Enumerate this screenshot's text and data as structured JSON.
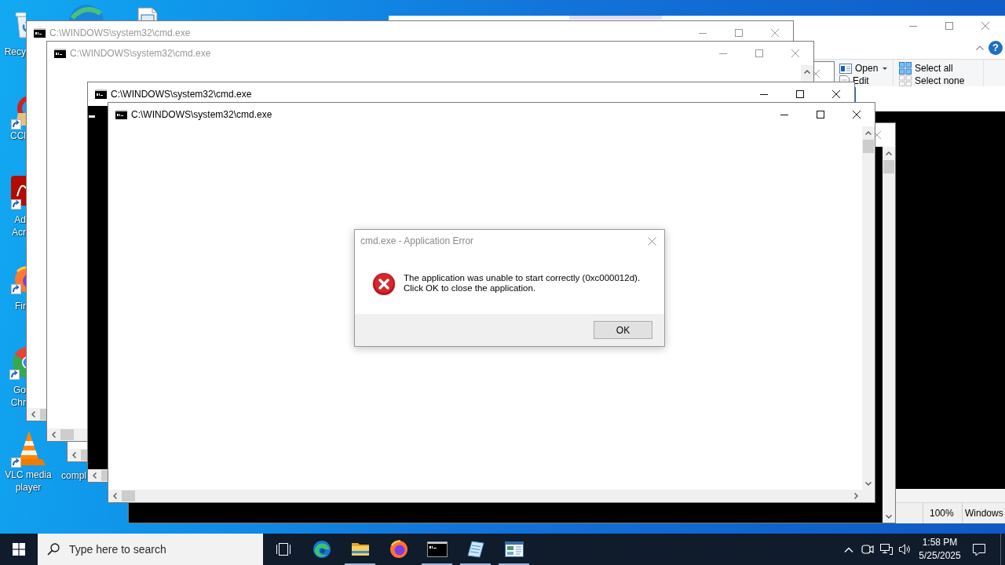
{
  "desktop_icons": [
    {
      "kind": "recycle",
      "label_lines": [
        "Recy"
      ]
    },
    {
      "kind": "swirl"
    },
    {
      "kind": "document"
    },
    {
      "kind": "cleaner",
      "label_lines": [
        "CCl"
      ]
    },
    {
      "kind": "pdf",
      "label_lines": [
        "Ad",
        "Acr"
      ]
    },
    {
      "kind": "fox",
      "label_lines": [
        "Fir"
      ]
    },
    {
      "kind": "browser",
      "label_lines": [
        "Go",
        "Chr"
      ]
    },
    {
      "kind": "cone",
      "label_lines": [
        "VLC media",
        "player"
      ]
    },
    {
      "kind": "hidden",
      "label_lines": [
        "compl"
      ]
    }
  ],
  "explorer": {
    "ribbon_groups": [
      {
        "items": [
          {
            "label": "Open",
            "kind": "open",
            "dropdown": true
          },
          {
            "label": "Edit",
            "kind": "edit",
            "dropdown": false
          }
        ]
      },
      {
        "items": [
          {
            "label": "Select all",
            "kind": "select_all",
            "dropdown": false
          },
          {
            "label": "Select none",
            "kind": "select_none",
            "dropdown": false
          }
        ]
      }
    ],
    "help": "?"
  },
  "back_window": {
    "status_bar": [
      "100%",
      "Windows"
    ]
  },
  "windows": [
    {
      "title": "C:\\WINDOWS\\system32\\cmd.exe",
      "dimmed": true,
      "kind": "blank"
    },
    {
      "title": "C:\\WINDOWS\\system32\\cmd.exe",
      "dimmed": true,
      "kind": "blank"
    },
    {
      "dimmed": true,
      "kind": "blank"
    },
    {
      "title": "C:\\WINDOWS\\system32\\cmd.exe",
      "dimmed": false,
      "kind": "prompt"
    },
    {
      "title": "C:\\WINDOWS\\system32\\cmd.exe",
      "dimmed": false,
      "kind": "blank"
    },
    {
      "dimmed": true,
      "kind": "console"
    }
  ],
  "dialog": {
    "title": "cmd.exe - Application Error",
    "message_lines": [
      "The application was unable to start correctly (0xc000012d).",
      "Click OK to close the application."
    ],
    "button": "OK"
  },
  "taskbar": {
    "search": {
      "placeholder": "Type here to search"
    },
    "apps": [
      {
        "kind": "swirl",
        "running": false
      },
      {
        "kind": "folder",
        "running": true
      },
      {
        "kind": "fox",
        "running": false
      },
      {
        "kind": "console",
        "running": true
      },
      {
        "kind": "notepad",
        "running": true
      },
      {
        "kind": "form",
        "running": true
      }
    ],
    "clock": {
      "time": "1:58 PM",
      "date": "5/25/2025"
    }
  }
}
